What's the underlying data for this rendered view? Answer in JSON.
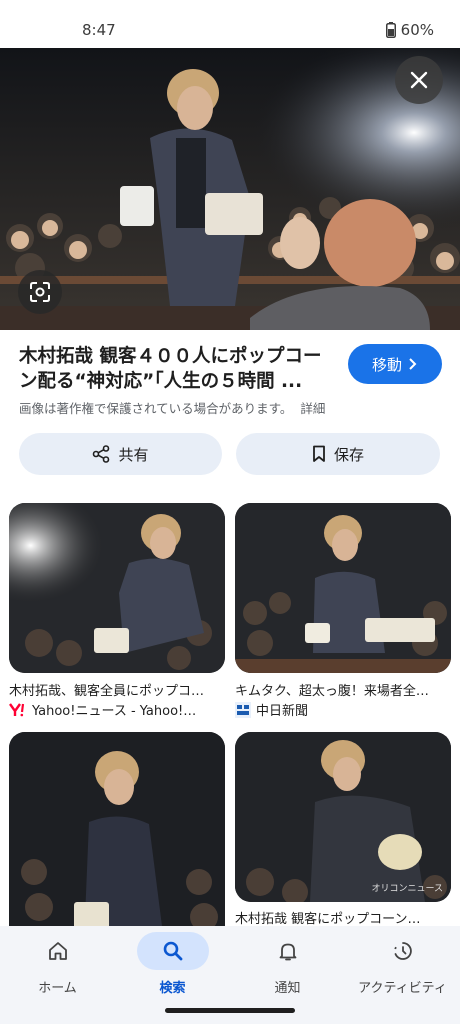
{
  "status": {
    "time": "8:47",
    "battery": "60%"
  },
  "result": {
    "title": "木村拓哉 観客４００人にポップコーン配る“神対応”「人生の５時間 ...",
    "visit_label": "移動",
    "copyright": "画像は著作権で保護されている場合があります。",
    "details_label": "詳細"
  },
  "actions": {
    "share_label": "共有",
    "save_label": "保存"
  },
  "grid": [
    {
      "caption": "木村拓哉、観客全員にポップコ…",
      "source": "Yahoo!ニュース - Yahoo!…",
      "source_icon": "yahoo-logo"
    },
    {
      "caption": "キムタク、超太っ腹！来場者全…",
      "source": "中日新聞",
      "source_icon": "chunichi-logo"
    },
    {
      "caption": "",
      "source": "",
      "source_icon": ""
    },
    {
      "caption": "木村拓哉 観客にポップコーン…",
      "source": "",
      "source_icon": ""
    }
  ],
  "watermark": "オリコンニュース",
  "nav": [
    {
      "label": "ホーム",
      "icon": "home-icon",
      "active": false
    },
    {
      "label": "検索",
      "icon": "search-icon",
      "active": true
    },
    {
      "label": "通知",
      "icon": "bell-icon",
      "active": false
    },
    {
      "label": "アクティビティ",
      "icon": "activity-icon",
      "active": false
    }
  ],
  "colors": {
    "accent": "#1a73e8",
    "nav_active": "#0b57d0",
    "chip_bg": "#e8eef7",
    "nav_bg": "#f3f5f9"
  }
}
